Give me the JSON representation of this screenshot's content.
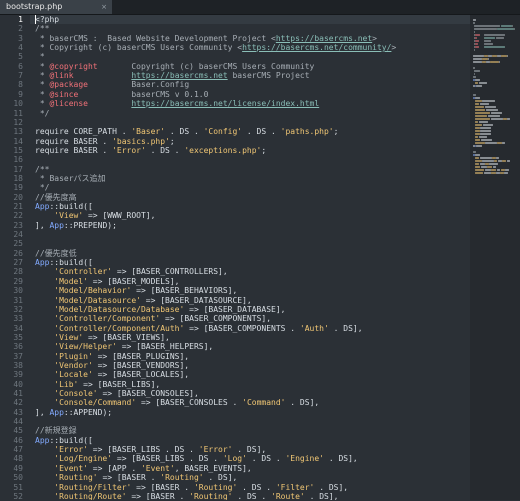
{
  "tab": {
    "title": "bootstrap.php",
    "close": "×"
  },
  "lines": [
    {
      "n": "1",
      "segs": [
        [
          "k",
          "<?php"
        ]
      ]
    },
    {
      "n": "2",
      "segs": [
        [
          "c",
          "/**"
        ]
      ]
    },
    {
      "n": "3",
      "segs": [
        [
          "c",
          " * baserCMS :  Based Website Development Project <"
        ],
        [
          "u",
          "https://basercms.net"
        ],
        [
          "c",
          ">"
        ]
      ]
    },
    {
      "n": "4",
      "segs": [
        [
          "c",
          " * Copyright (c) baserCMS Users Community <"
        ],
        [
          "u",
          "https://basercms.net/community/"
        ],
        [
          "c",
          ">"
        ]
      ]
    },
    {
      "n": "5",
      "segs": [
        [
          "c",
          " *"
        ]
      ]
    },
    {
      "n": "6",
      "segs": [
        [
          "c",
          " * "
        ],
        [
          "t",
          "@copyright"
        ],
        [
          "c",
          "       Copyright (c) baserCMS Users Community"
        ]
      ]
    },
    {
      "n": "7",
      "segs": [
        [
          "c",
          " * "
        ],
        [
          "t",
          "@link"
        ],
        [
          "c",
          "            "
        ],
        [
          "u",
          "https://basercms.net"
        ],
        [
          "c",
          " baserCMS Project"
        ]
      ]
    },
    {
      "n": "8",
      "segs": [
        [
          "c",
          " * "
        ],
        [
          "t",
          "@package"
        ],
        [
          "c",
          "         Baser.Config"
        ]
      ]
    },
    {
      "n": "9",
      "segs": [
        [
          "c",
          " * "
        ],
        [
          "t",
          "@since"
        ],
        [
          "c",
          "           baserCMS v 0.1.0"
        ]
      ]
    },
    {
      "n": "10",
      "segs": [
        [
          "c",
          " * "
        ],
        [
          "t",
          "@license"
        ],
        [
          "c",
          "         "
        ],
        [
          "u",
          "https://basercms.net/license/index.html"
        ]
      ]
    },
    {
      "n": "11",
      "segs": [
        [
          "c",
          " */"
        ]
      ]
    },
    {
      "n": "12",
      "segs": [
        [
          "k",
          ""
        ]
      ]
    },
    {
      "n": "13",
      "segs": [
        [
          "k",
          "require CORE_PATH . "
        ],
        [
          "s",
          "'Baser'"
        ],
        [
          "k",
          " . DS . "
        ],
        [
          "s",
          "'Config'"
        ],
        [
          "k",
          " . DS . "
        ],
        [
          "s",
          "'paths.php'"
        ],
        [
          "k",
          ";"
        ]
      ]
    },
    {
      "n": "14",
      "segs": [
        [
          "k",
          "require BASER . "
        ],
        [
          "s",
          "'basics.php'"
        ],
        [
          "k",
          ";"
        ]
      ]
    },
    {
      "n": "15",
      "segs": [
        [
          "k",
          "require BASER . "
        ],
        [
          "s",
          "'Error'"
        ],
        [
          "k",
          " . DS . "
        ],
        [
          "s",
          "'exceptions.php'"
        ],
        [
          "k",
          ";"
        ]
      ]
    },
    {
      "n": "16",
      "segs": [
        [
          "k",
          ""
        ]
      ]
    },
    {
      "n": "17",
      "segs": [
        [
          "c",
          "/**"
        ]
      ]
    },
    {
      "n": "18",
      "segs": [
        [
          "c",
          " * Baserパス追加"
        ]
      ]
    },
    {
      "n": "19",
      "segs": [
        [
          "c",
          " */"
        ]
      ]
    },
    {
      "n": "20",
      "segs": [
        [
          "c",
          "//優先度高"
        ]
      ]
    },
    {
      "n": "21",
      "segs": [
        [
          "a",
          "App"
        ],
        [
          "k",
          "::build(["
        ]
      ]
    },
    {
      "n": "22",
      "segs": [
        [
          "k",
          "    "
        ],
        [
          "s",
          "'View'"
        ],
        [
          "k",
          " => [WWW_ROOT],"
        ]
      ]
    },
    {
      "n": "23",
      "segs": [
        [
          "k",
          "], "
        ],
        [
          "a",
          "App"
        ],
        [
          "k",
          "::PREPEND);"
        ]
      ]
    },
    {
      "n": "24",
      "segs": [
        [
          "k",
          ""
        ]
      ]
    },
    {
      "n": "25",
      "segs": [
        [
          "k",
          ""
        ]
      ]
    },
    {
      "n": "26",
      "segs": [
        [
          "c",
          "//優先度低"
        ]
      ]
    },
    {
      "n": "27",
      "segs": [
        [
          "a",
          "App"
        ],
        [
          "k",
          "::build(["
        ]
      ]
    },
    {
      "n": "28",
      "segs": [
        [
          "k",
          "    "
        ],
        [
          "s",
          "'Controller'"
        ],
        [
          "k",
          " => [BASER_CONTROLLERS],"
        ]
      ]
    },
    {
      "n": "29",
      "segs": [
        [
          "k",
          "    "
        ],
        [
          "s",
          "'Model'"
        ],
        [
          "k",
          " => [BASER_MODELS],"
        ]
      ]
    },
    {
      "n": "30",
      "segs": [
        [
          "k",
          "    "
        ],
        [
          "s",
          "'Model/Behavior'"
        ],
        [
          "k",
          " => [BASER_BEHAVIORS],"
        ]
      ]
    },
    {
      "n": "31",
      "segs": [
        [
          "k",
          "    "
        ],
        [
          "s",
          "'Model/Datasource'"
        ],
        [
          "k",
          " => [BASER_DATASOURCE],"
        ]
      ]
    },
    {
      "n": "32",
      "segs": [
        [
          "k",
          "    "
        ],
        [
          "s",
          "'Model/Datasource/Database'"
        ],
        [
          "k",
          " => [BASER_DATABASE],"
        ]
      ]
    },
    {
      "n": "33",
      "segs": [
        [
          "k",
          "    "
        ],
        [
          "s",
          "'Controller/Component'"
        ],
        [
          "k",
          " => [BASER_COMPONENTS],"
        ]
      ]
    },
    {
      "n": "34",
      "segs": [
        [
          "k",
          "    "
        ],
        [
          "s",
          "'Controller/Component/Auth'"
        ],
        [
          "k",
          " => [BASER_COMPONENTS . "
        ],
        [
          "s",
          "'Auth'"
        ],
        [
          "k",
          " . DS],"
        ]
      ]
    },
    {
      "n": "35",
      "segs": [
        [
          "k",
          "    "
        ],
        [
          "s",
          "'View'"
        ],
        [
          "k",
          " => [BASER_VIEWS],"
        ]
      ]
    },
    {
      "n": "36",
      "segs": [
        [
          "k",
          "    "
        ],
        [
          "s",
          "'View/Helper'"
        ],
        [
          "k",
          " => [BASER_HELPERS],"
        ]
      ]
    },
    {
      "n": "37",
      "segs": [
        [
          "k",
          "    "
        ],
        [
          "s",
          "'Plugin'"
        ],
        [
          "k",
          " => [BASER_PLUGINS],"
        ]
      ]
    },
    {
      "n": "38",
      "segs": [
        [
          "k",
          "    "
        ],
        [
          "s",
          "'Vendor'"
        ],
        [
          "k",
          " => [BASER_VENDORS],"
        ]
      ]
    },
    {
      "n": "39",
      "segs": [
        [
          "k",
          "    "
        ],
        [
          "s",
          "'Locale'"
        ],
        [
          "k",
          " => [BASER_LOCALES],"
        ]
      ]
    },
    {
      "n": "40",
      "segs": [
        [
          "k",
          "    "
        ],
        [
          "s",
          "'Lib'"
        ],
        [
          "k",
          " => [BASER_LIBS],"
        ]
      ]
    },
    {
      "n": "41",
      "segs": [
        [
          "k",
          "    "
        ],
        [
          "s",
          "'Console'"
        ],
        [
          "k",
          " => [BASER_CONSOLES],"
        ]
      ]
    },
    {
      "n": "42",
      "segs": [
        [
          "k",
          "    "
        ],
        [
          "s",
          "'Console/Command'"
        ],
        [
          "k",
          " => [BASER_CONSOLES . "
        ],
        [
          "s",
          "'Command'"
        ],
        [
          "k",
          " . DS],"
        ]
      ]
    },
    {
      "n": "43",
      "segs": [
        [
          "k",
          "], "
        ],
        [
          "a",
          "App"
        ],
        [
          "k",
          "::APPEND);"
        ]
      ]
    },
    {
      "n": "44",
      "segs": [
        [
          "k",
          ""
        ]
      ]
    },
    {
      "n": "45",
      "segs": [
        [
          "c",
          "//新規登録"
        ]
      ]
    },
    {
      "n": "46",
      "segs": [
        [
          "a",
          "App"
        ],
        [
          "k",
          "::build(["
        ]
      ]
    },
    {
      "n": "47",
      "segs": [
        [
          "k",
          "    "
        ],
        [
          "s",
          "'Error'"
        ],
        [
          "k",
          " => [BASER_LIBS . DS . "
        ],
        [
          "s",
          "'Error'"
        ],
        [
          "k",
          " . DS],"
        ]
      ]
    },
    {
      "n": "48",
      "segs": [
        [
          "k",
          "    "
        ],
        [
          "s",
          "'Log/Engine'"
        ],
        [
          "k",
          " => [BASER_LIBS . DS . "
        ],
        [
          "s",
          "'Log'"
        ],
        [
          "k",
          " . DS . "
        ],
        [
          "s",
          "'Engine'"
        ],
        [
          "k",
          " . DS],"
        ]
      ]
    },
    {
      "n": "49",
      "segs": [
        [
          "k",
          "    "
        ],
        [
          "s",
          "'Event'"
        ],
        [
          "k",
          " => [APP . "
        ],
        [
          "s",
          "'Event'"
        ],
        [
          "k",
          ", BASER_EVENTS],"
        ]
      ]
    },
    {
      "n": "50",
      "segs": [
        [
          "k",
          "    "
        ],
        [
          "s",
          "'Routing'"
        ],
        [
          "k",
          " => [BASER . "
        ],
        [
          "s",
          "'Routing'"
        ],
        [
          "k",
          " . DS],"
        ]
      ]
    },
    {
      "n": "51",
      "segs": [
        [
          "k",
          "    "
        ],
        [
          "s",
          "'Routing/Filter'"
        ],
        [
          "k",
          " => [BASER . "
        ],
        [
          "s",
          "'Routing'"
        ],
        [
          "k",
          " . DS . "
        ],
        [
          "s",
          "'Filter'"
        ],
        [
          "k",
          " . DS],"
        ]
      ]
    },
    {
      "n": "52",
      "segs": [
        [
          "k",
          "    "
        ],
        [
          "s",
          "'Routing/Route'"
        ],
        [
          "k",
          " => [BASER . "
        ],
        [
          "s",
          "'Routing'"
        ],
        [
          "k",
          " . DS . "
        ],
        [
          "s",
          "'Route'"
        ],
        [
          "k",
          " . DS],"
        ]
      ]
    }
  ],
  "colors": {
    "k": "#d8dee4",
    "c": "#a7aeb5",
    "s": "#f0c674",
    "u": "#8abeb7",
    "t": "#f07178",
    "a": "#82aaff"
  }
}
